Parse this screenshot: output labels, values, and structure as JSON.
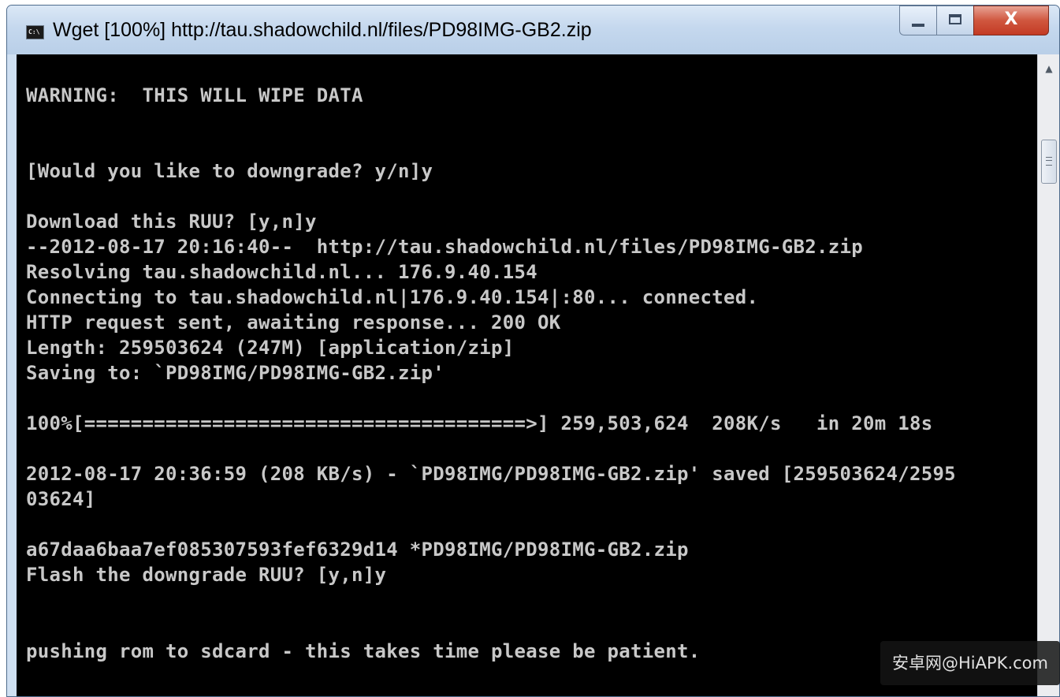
{
  "window": {
    "title": "Wget [100%] http://tau.shadowchild.nl/files/PD98IMG-GB2.zip",
    "app_icon": "console-icon",
    "controls": {
      "minimize": "minimize-icon",
      "maximize": "maximize-icon",
      "close": "close-icon"
    },
    "close_label": "X"
  },
  "console": {
    "background_color": "#000000",
    "text_color": "#c8c8c8",
    "lines": [
      "WARNING:  THIS WILL WIPE DATA",
      "[Would you like to downgrade? y/n]y",
      "Download this RUU? [y,n]y",
      "--2012-08-17 20:16:40--  http://tau.shadowchild.nl/files/PD98IMG-GB2.zip",
      "Resolving tau.shadowchild.nl... 176.9.40.154",
      "Connecting to tau.shadowchild.nl|176.9.40.154|:80... connected.",
      "HTTP request sent, awaiting response... 200 OK",
      "Length: 259503624 (247M) [application/zip]",
      "Saving to: `PD98IMG/PD98IMG-GB2.zip'",
      "100%[======================================>] 259,503,624  208K/s   in 20m 18s",
      "2012-08-17 20:36:59 (208 KB/s) - `PD98IMG/PD98IMG-GB2.zip' saved [259503624/2595",
      "03624]",
      "a67daa6baa7ef085307593fef6329d14 *PD98IMG/PD98IMG-GB2.zip",
      "Flash the downgrade RUU? [y,n]y",
      "pushing rom to sdcard - this takes time please be patient."
    ]
  },
  "scrollbar": {
    "up_arrow": "scroll-up-arrow-icon",
    "arrow_glyph": "▲"
  },
  "watermark": {
    "text": "安卓网@HiAPK.com"
  }
}
